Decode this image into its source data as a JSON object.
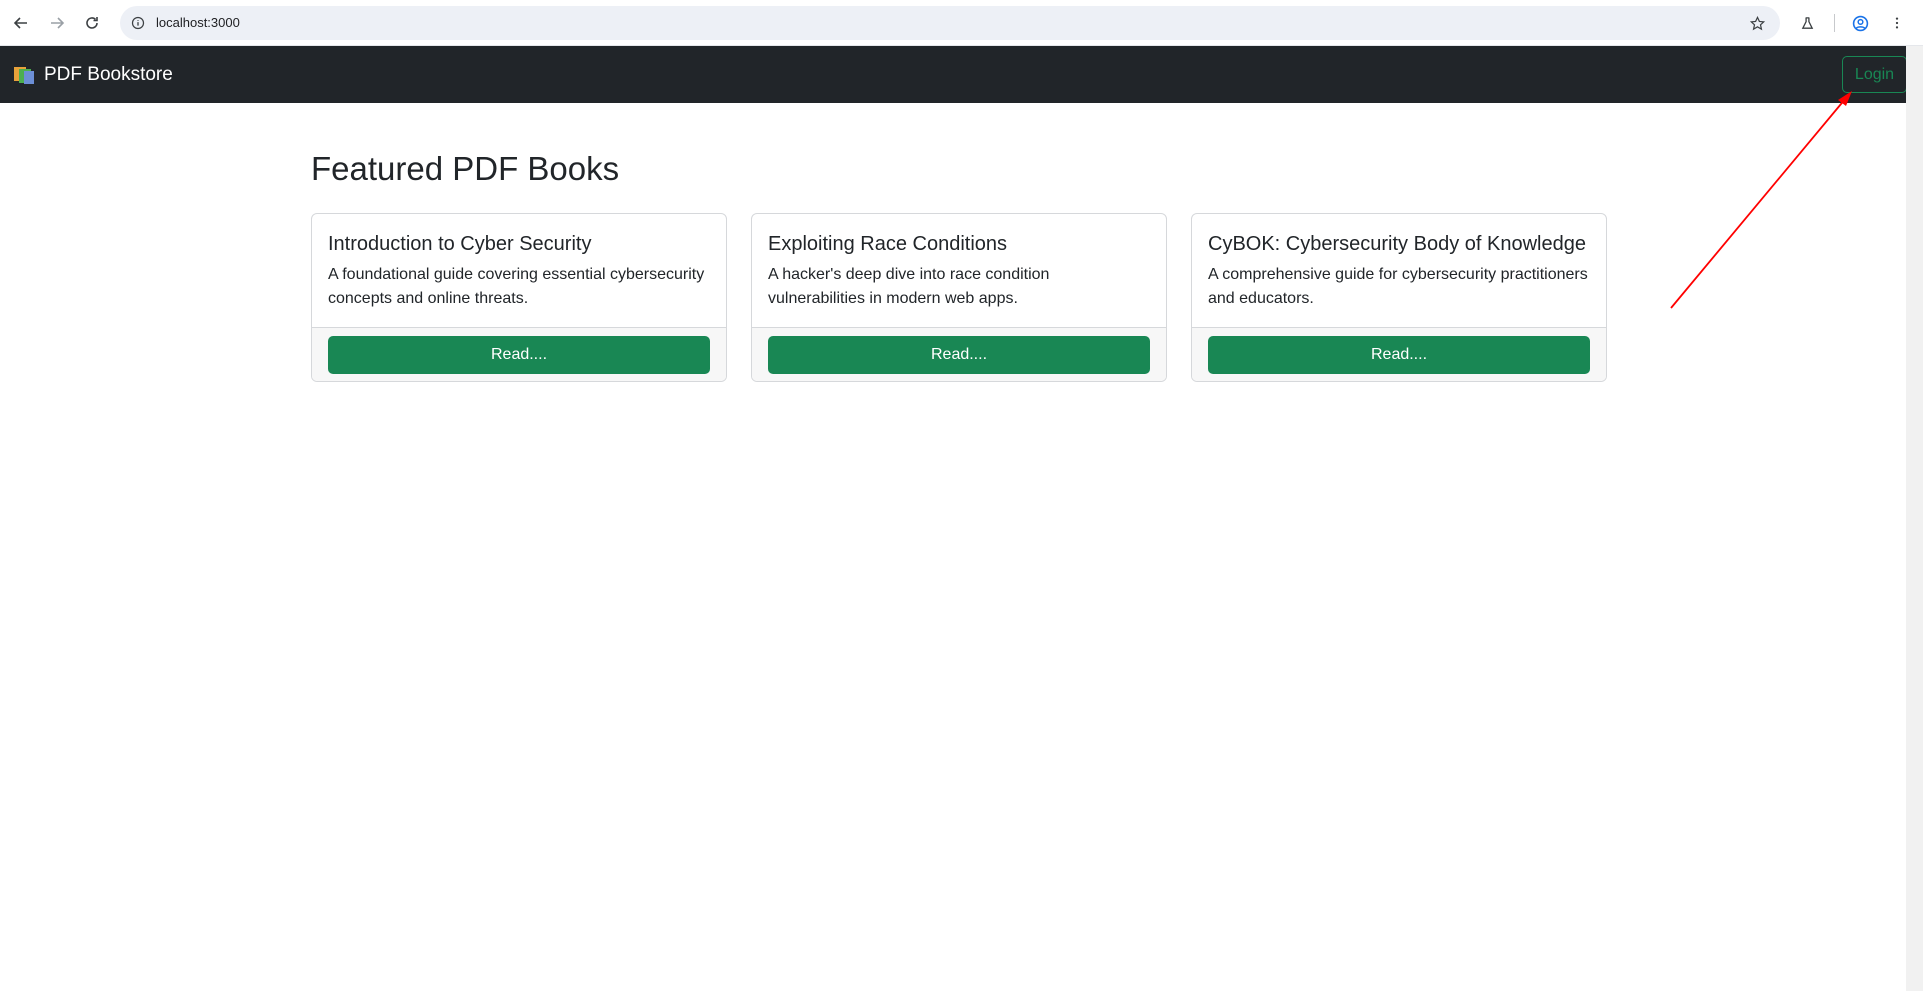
{
  "browser": {
    "url": "localhost:3000"
  },
  "navbar": {
    "brand": "PDF Bookstore",
    "login_label": "Login"
  },
  "main": {
    "title": "Featured PDF Books",
    "books": [
      {
        "title": "Introduction to Cyber Security",
        "description": "A foundational guide covering essential cybersecurity concepts and online threats.",
        "button": "Read...."
      },
      {
        "title": "Exploiting Race Conditions",
        "description": "A hacker's deep dive into race condition vulnerabilities in modern web apps.",
        "button": "Read...."
      },
      {
        "title": "CyBOK: Cybersecurity Body of Knowledge",
        "description": "A comprehensive guide for cybersecurity practitioners and educators.",
        "button": "Read...."
      }
    ]
  },
  "colors": {
    "navbar_bg": "#212529",
    "accent_green": "#198754",
    "annotation_arrow": "#ff0000"
  }
}
